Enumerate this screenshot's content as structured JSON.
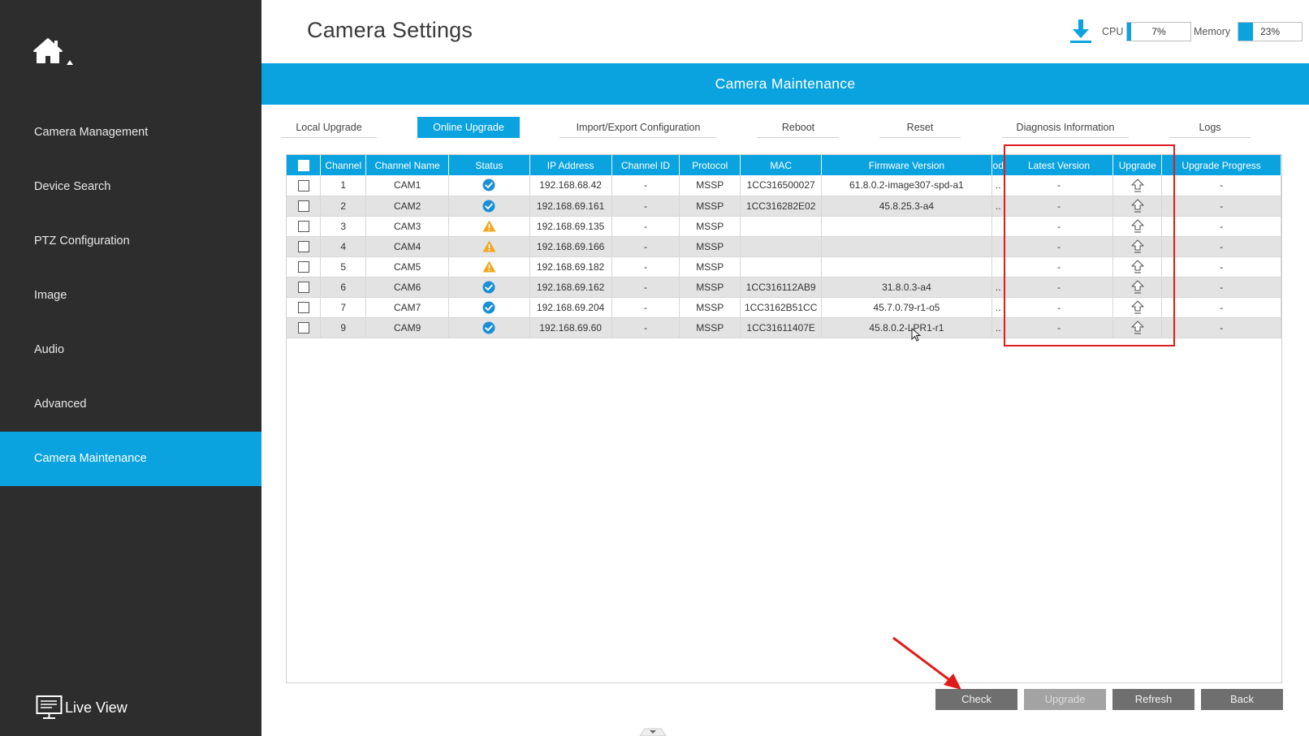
{
  "header": {
    "title": "Camera Settings",
    "cpu_label": "CPU",
    "cpu_value": "7%",
    "cpu_percent": 7,
    "memory_label": "Memory",
    "memory_value": "23%",
    "memory_percent": 23
  },
  "sidebar": {
    "home_icon": "home-icon",
    "items": [
      {
        "label": "Camera Management"
      },
      {
        "label": "Device Search"
      },
      {
        "label": "PTZ Configuration"
      },
      {
        "label": "Image"
      },
      {
        "label": "Audio"
      },
      {
        "label": "Advanced"
      },
      {
        "label": "Camera Maintenance",
        "active": true
      }
    ],
    "live_view": "Live View"
  },
  "banner": {
    "title": "Camera Maintenance"
  },
  "tabs": [
    {
      "label": "Local Upgrade"
    },
    {
      "label": "Online Upgrade",
      "active": true
    },
    {
      "label": "Import/Export Configuration"
    },
    {
      "label": "Reboot"
    },
    {
      "label": "Reset"
    },
    {
      "label": "Diagnosis Information"
    },
    {
      "label": "Logs"
    }
  ],
  "table": {
    "columns": [
      "Channel",
      "Channel Name",
      "Status",
      "IP Address",
      "Channel ID",
      "Protocol",
      "MAC",
      "Firmware Version",
      "od",
      "Latest Version",
      "Upgrade",
      "Upgrade Progress"
    ],
    "rows": [
      {
        "channel": "1",
        "name": "CAM1",
        "status": "ok",
        "ip": "192.168.68.42",
        "channel_id": "-",
        "protocol": "MSSP",
        "mac": "1CC316500027",
        "firmware": "61.8.0.2-image307-spd-a1",
        "od": "..",
        "latest": "-",
        "progress": "-"
      },
      {
        "channel": "2",
        "name": "CAM2",
        "status": "ok",
        "ip": "192.168.69.161",
        "channel_id": "-",
        "protocol": "MSSP",
        "mac": "1CC316282E02",
        "firmware": "45.8.25.3-a4",
        "od": "..",
        "latest": "-",
        "progress": "-"
      },
      {
        "channel": "3",
        "name": "CAM3",
        "status": "warning",
        "ip": "192.168.69.135",
        "channel_id": "-",
        "protocol": "MSSP",
        "mac": "",
        "firmware": "",
        "od": "",
        "latest": "-",
        "progress": "-"
      },
      {
        "channel": "4",
        "name": "CAM4",
        "status": "warning",
        "ip": "192.168.69.166",
        "channel_id": "-",
        "protocol": "MSSP",
        "mac": "",
        "firmware": "",
        "od": "",
        "latest": "-",
        "progress": "-"
      },
      {
        "channel": "5",
        "name": "CAM5",
        "status": "warning",
        "ip": "192.168.69.182",
        "channel_id": "-",
        "protocol": "MSSP",
        "mac": "",
        "firmware": "",
        "od": "",
        "latest": "-",
        "progress": "-"
      },
      {
        "channel": "6",
        "name": "CAM6",
        "status": "ok",
        "ip": "192.168.69.162",
        "channel_id": "-",
        "protocol": "MSSP",
        "mac": "1CC316112AB9",
        "firmware": "31.8.0.3-a4",
        "od": "..",
        "latest": "-",
        "progress": "-"
      },
      {
        "channel": "7",
        "name": "CAM7",
        "status": "ok",
        "ip": "192.168.69.204",
        "channel_id": "-",
        "protocol": "MSSP",
        "mac": "1CC3162B51CC",
        "firmware": "45.7.0.79-r1-o5",
        "od": "..",
        "latest": "-",
        "progress": "-"
      },
      {
        "channel": "9",
        "name": "CAM9",
        "status": "ok",
        "ip": "192.168.69.60",
        "channel_id": "-",
        "protocol": "MSSP",
        "mac": "1CC31611407E",
        "firmware": "45.8.0.2-LPR1-r1",
        "od": "..",
        "latest": "-",
        "progress": "-"
      }
    ]
  },
  "buttons": {
    "check": "Check",
    "upgrade": "Upgrade",
    "refresh": "Refresh",
    "back": "Back"
  },
  "colors": {
    "accent": "#0aa3e0",
    "sidebar": "#2d2d2d",
    "status_ok": "#1a8fd6",
    "status_warning": "#f0a81e",
    "annotation": "#e01b1b"
  }
}
